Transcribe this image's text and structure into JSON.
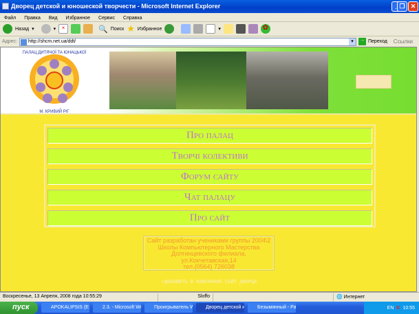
{
  "window": {
    "title": "Дворец детской и юношеской творчести - Microsoft Internet Explorer"
  },
  "menubar": [
    "Файл",
    "Правка",
    "Вид",
    "Избранное",
    "Сервис",
    "Справка"
  ],
  "toolbar": {
    "back": "Назад",
    "search": "Поиск",
    "favorites": "Избранное"
  },
  "address": {
    "label": "Адрес:",
    "url": "http://shcm.net.ua/ddt/",
    "go": "Переход",
    "links": "Ссылки"
  },
  "header": {
    "logo_text": "Палац дитячої та юнацької творчості м. Кривий Ріг"
  },
  "nav": [
    "Про палац",
    "Творчі колективи",
    "Форум сайту",
    "Чат палацу",
    "Про сайт"
  ],
  "footer": {
    "lines": [
      "Сайт разработан учениками группы 2004\\2",
      "Школы Компьютерного Мастерства",
      "Долгинцевского филиала,",
      "ул.Кокчетавская,14",
      "тел.(0564) 726038"
    ],
    "favorite_link": "+ДОБАВИТЬ В ИЗБРАННОЕ САЙТ ДВОРЦА"
  },
  "status": {
    "text": "Воскресенье, 13 Апреля, 2008 года  10:55:29",
    "middle": "Sloffo",
    "zone": "Интернет"
  },
  "taskbar": {
    "start": "пуск",
    "tasks": [
      "APOKALIPSIS (E:)",
      "2.3. - Microsoft Word",
      "Проигрыватель Wi...",
      "Дворец детской и ...",
      "Безымянный - Paint"
    ],
    "lang": "EN",
    "clock": "10:55"
  }
}
